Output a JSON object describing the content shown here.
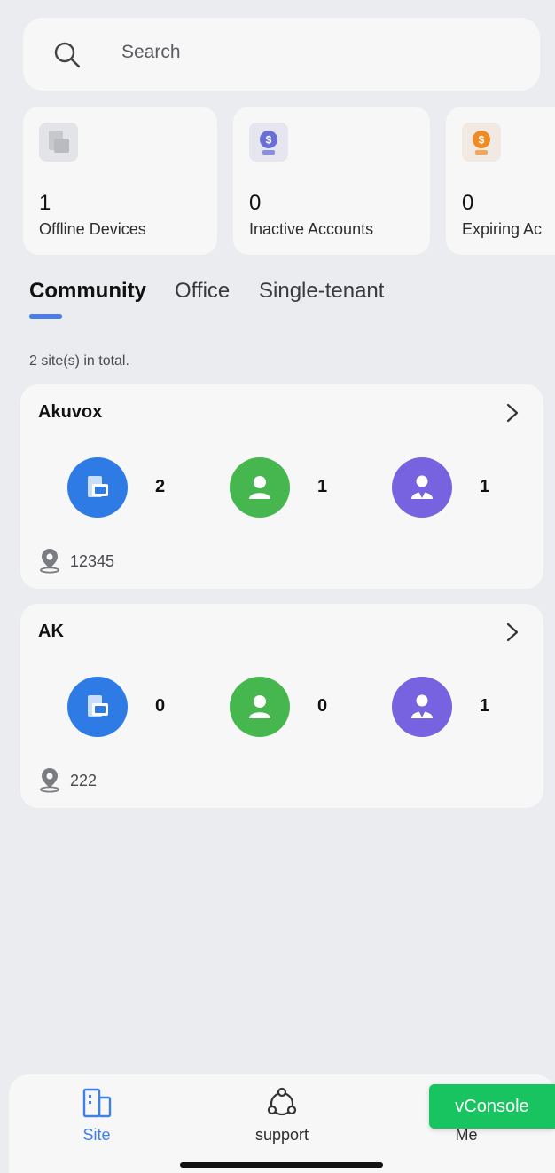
{
  "search": {
    "placeholder": "Search"
  },
  "stats": [
    {
      "value": "1",
      "label": "Offline Devices",
      "icon": "device-icon",
      "color": "#c9cbcf"
    },
    {
      "value": "0",
      "label": "Inactive Accounts",
      "icon": "inactive-account-icon",
      "color": "#6a6fd6"
    },
    {
      "value": "0",
      "label": "Expiring Ac",
      "icon": "expiring-account-icon",
      "color": "#f08a24"
    }
  ],
  "tabs": [
    {
      "label": "Community",
      "active": true
    },
    {
      "label": "Office",
      "active": false
    },
    {
      "label": "Single-tenant",
      "active": false
    }
  ],
  "total_text": "2 site(s) in total.",
  "sites": [
    {
      "name": "Akuvox",
      "devices": "2",
      "residents": "1",
      "managers": "1",
      "location": "12345"
    },
    {
      "name": "AK",
      "devices": "0",
      "residents": "0",
      "managers": "1",
      "location": "222"
    }
  ],
  "nav": {
    "site_label": "Site",
    "support_label": "support",
    "me_label": "Me"
  },
  "vconsole_label": "vConsole",
  "colors": {
    "accent": "#4a7ee4",
    "device_blue": "#2f7be6",
    "resident_green": "#46b64f",
    "manager_purple": "#7763e0",
    "vconsole_green": "#18c460"
  }
}
